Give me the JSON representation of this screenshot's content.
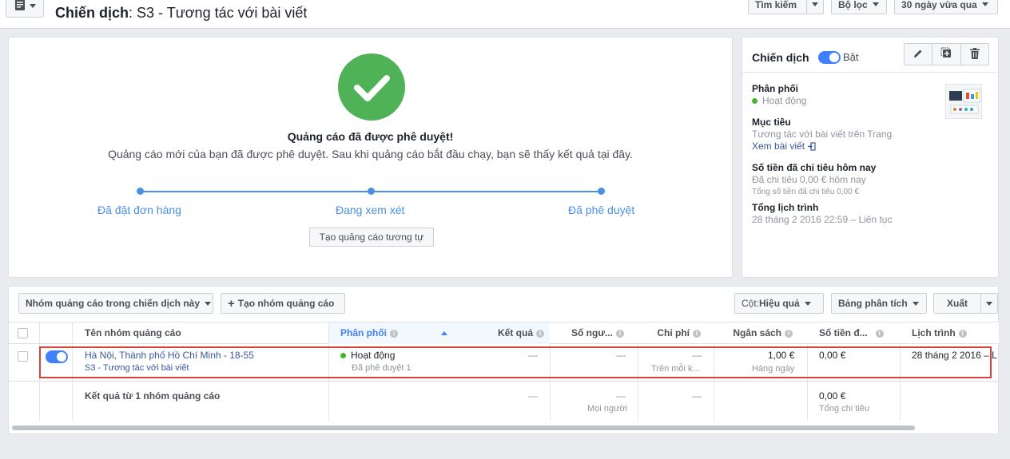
{
  "header": {
    "title_bold": "Chiến dịch",
    "title_rest": ": S3 - Tương tác với bài viết",
    "search_label": "Tìm kiếm",
    "filter_label": "Bộ lọc",
    "date_label": "30 ngày vừa qua"
  },
  "approved": {
    "title": "Quảng cáo đã được phê duyệt!",
    "subtitle": "Quảng cáo mới của bạn đã được phê duyệt. Sau khi quảng cáo bắt đầu chạy, bạn sẽ thấy kết quả tại đây.",
    "steps": [
      "Đã đặt đơn hàng",
      "Đang xem xét",
      "Đã phê duyệt"
    ],
    "similar_button": "Tạo quảng cáo tương tự"
  },
  "campaign": {
    "title": "Chiến dịch",
    "toggle_label": "Bật",
    "delivery_label": "Phân phối",
    "delivery_status": "Hoạt động",
    "objective_label": "Mục tiêu",
    "objective_value": "Tương tác với bài viết trên Trang",
    "view_post": "Xem bài viết",
    "spend_label": "Số tiền đã chi tiêu hôm nay",
    "spend_today": "Đã chi tiêu 0,00 € hôm nay",
    "spend_total": "Tổng số tiền đã chi tiêu 0,00 €",
    "schedule_label": "Tổng lịch trình",
    "schedule_value": "28 tháng 2 2016 22:59 – Liên tục"
  },
  "toolbar": {
    "adsets_dropdown": "Nhóm quảng cáo trong chiến dịch này",
    "create_adset": "Tạo nhóm quảng cáo",
    "columns_label": "Cột: ",
    "columns_value": "Hiệu quả",
    "breakdown": "Bảng phân tích",
    "export": "Xuất"
  },
  "table": {
    "columns": [
      "Tên nhóm quảng cáo",
      "Phân phối",
      "Kết quả",
      "Số ngư...",
      "Chi phí",
      "Ngân sách",
      "Số tiền đ...",
      "Lịch trình"
    ],
    "row": {
      "name": "Hà Nội, Thành phố Hồ Chí Minh - 18-55",
      "campaign": "S3 - Tương tác với bài viết",
      "delivery": "Hoạt động",
      "delivery_sub": "Đã phê duyệt 1",
      "results": "—",
      "reach": "—",
      "cost": "—",
      "cost_sub": "Trên mỗi k...",
      "budget": "1,00 €",
      "budget_sub": "Hàng ngày",
      "spent": "0,00 €",
      "schedule": "28 tháng 2 2016 – L"
    },
    "summary": {
      "label": "Kết quả từ 1 nhóm quảng cáo",
      "results": "—",
      "reach": "—",
      "reach_sub": "Mọi người",
      "cost": "—",
      "spent": "0,00 €",
      "spent_sub": "Tổng chi tiêu"
    }
  },
  "colors": {
    "accent": "#4080ff",
    "success": "#4fb256",
    "link": "#365899",
    "highlight": "#d9413a"
  }
}
